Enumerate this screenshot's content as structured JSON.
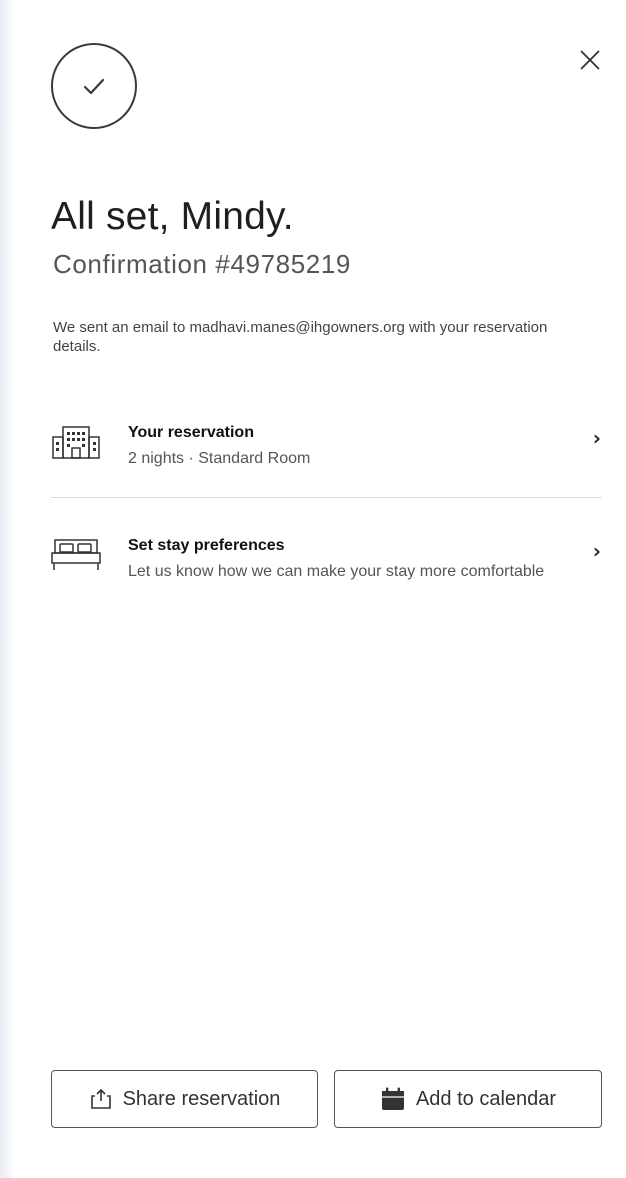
{
  "header": {
    "success_icon": "checkmark-circle-icon",
    "close_icon": "close-icon"
  },
  "confirmation": {
    "title": "All set, Mindy.",
    "number_line": "Confirmation #49785219",
    "email_note": "We sent an email to madhavi.manes@ihgowners.org with your reservation details."
  },
  "rows": [
    {
      "icon": "hotel-building-icon",
      "title": "Your reservation",
      "subtitle": "2 nights · Standard Room",
      "chevron": "›"
    },
    {
      "icon": "bed-icon",
      "title": "Set stay preferences",
      "subtitle": "Let us know how we can make your stay more comfortable",
      "chevron": "›"
    }
  ],
  "actions": {
    "share_label": "Share reservation",
    "share_icon": "share-icon",
    "calendar_label": "Add to calendar",
    "calendar_icon": "calendar-icon"
  }
}
